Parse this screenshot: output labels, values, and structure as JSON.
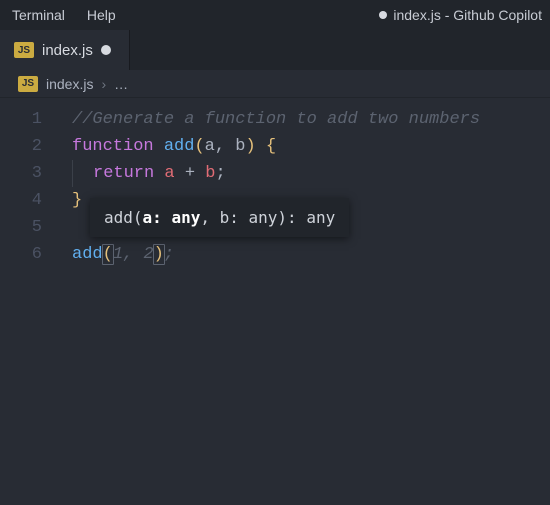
{
  "menu": {
    "terminal": "Terminal",
    "help": "Help"
  },
  "window_title": "index.js - Github Copilot",
  "tab": {
    "file": "index.js"
  },
  "breadcrumb": {
    "file": "index.js",
    "sep": "›",
    "more": "…"
  },
  "gutter": [
    "1",
    "2",
    "3",
    "4",
    "5",
    "6"
  ],
  "code": {
    "l1_comment": "//Generate a function to add two numbers",
    "l2": {
      "kw": "function",
      "fn": "add",
      "open": "(",
      "p1": "a",
      "comma": ", ",
      "p2": "b",
      "close": ")",
      "brace": "{"
    },
    "l3": {
      "kw": "return",
      "expr_a": "a",
      "plus": " + ",
      "expr_b": "b",
      "semi": ";"
    },
    "l4_brace": "}",
    "l6": {
      "fn": "add",
      "open": "(",
      "g1": "1",
      "gcomma": ", ",
      "g2": "2",
      "close": ")",
      "gsemi": ";"
    }
  },
  "sig": {
    "fn": "add",
    "open": "(",
    "p1n": "a:",
    "p1t": " any",
    "comma": ", ",
    "p2n": "b:",
    "p2t": " any",
    "close": "): ",
    "ret": "any"
  }
}
